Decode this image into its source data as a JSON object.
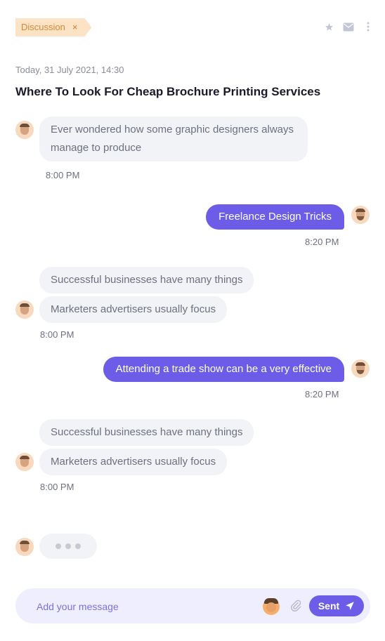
{
  "header": {
    "tag_label": "Discussion",
    "tag_close": "×"
  },
  "meta": {
    "date": "Today, 31 July 2021, 14:30",
    "title": "Where To Look For Cheap Brochure Printing Services"
  },
  "messages": [
    {
      "text": "Ever wondered how some graphic designers always manage to produce",
      "time": "8:00 PM"
    },
    {
      "text": "Freelance Design Tricks",
      "time": "8:20 PM"
    },
    {
      "text_a": "Successful businesses have many things",
      "text_b": "Marketers advertisers usually focus",
      "time": "8:00 PM"
    },
    {
      "text": "Attending a trade show can be a very effective",
      "time": "8:20 PM"
    },
    {
      "text_a": "Successful businesses have many things",
      "text_b": "Marketers advertisers usually focus",
      "time": "8:00 PM"
    }
  ],
  "composer": {
    "placeholder": "Add your message",
    "send_label": "Sent"
  },
  "colors": {
    "accent": "#6c5ce7",
    "tag_bg": "#fde3c5",
    "tag_text": "#d48a3a",
    "incoming_bubble": "#f2f3f6"
  }
}
